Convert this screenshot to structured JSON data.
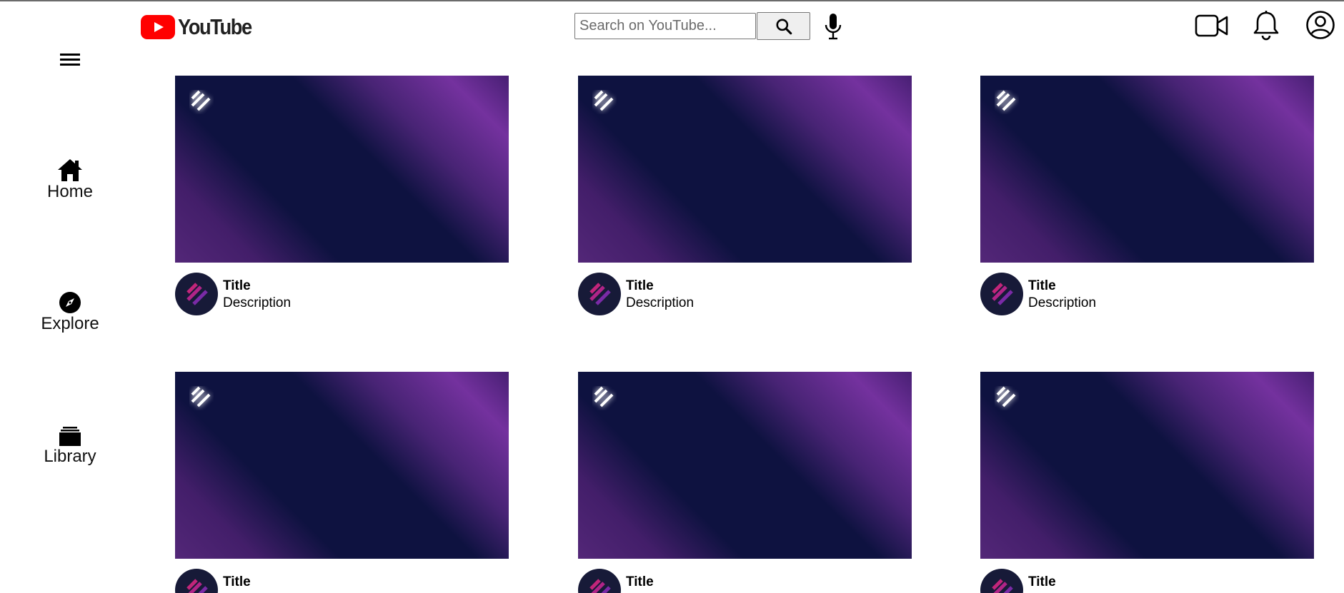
{
  "header": {
    "logo_text": "YouTube",
    "search_placeholder": "Search on YouTube...",
    "search_button_icon": "search-icon",
    "mic_icon": "microphone-icon",
    "right_icons": [
      "video-camera-icon",
      "bell-icon",
      "account-circle-icon"
    ]
  },
  "sidebar": {
    "menu_icon": "hamburger-menu-icon",
    "items": [
      {
        "label": "Home",
        "icon": "home-icon"
      },
      {
        "label": "Explore",
        "icon": "compass-icon"
      },
      {
        "label": "Library",
        "icon": "library-icon"
      }
    ]
  },
  "videos": [
    {
      "title": "Title",
      "description": "Description"
    },
    {
      "title": "Title",
      "description": "Description"
    },
    {
      "title": "Title",
      "description": "Description"
    },
    {
      "title": "Title",
      "description": ""
    },
    {
      "title": "Title",
      "description": ""
    },
    {
      "title": "Title",
      "description": ""
    }
  ],
  "colors": {
    "brand_red": "#ff0000",
    "thumbnail_bg": "#0e1240",
    "thumbnail_accent": "#8a3cb4"
  }
}
